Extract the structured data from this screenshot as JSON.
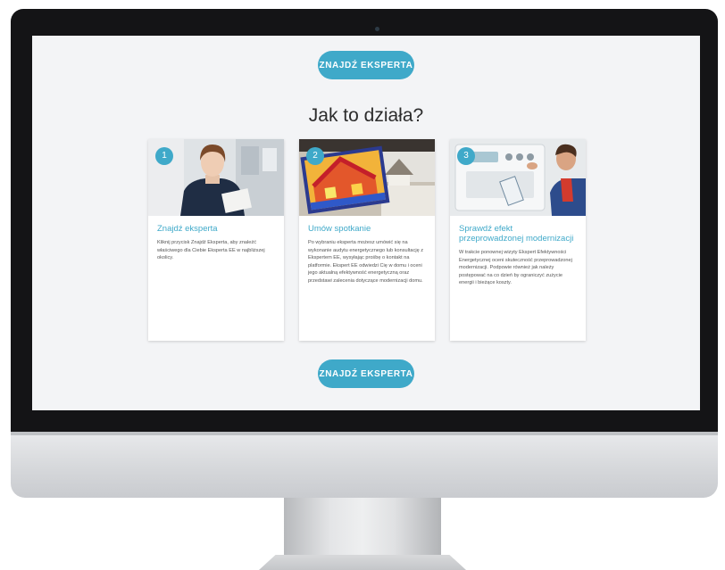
{
  "page": {
    "title": "Jak to działa?",
    "cta_top_label": "ZNAJDŹ EKSPERTA",
    "cta_bottom_label": "ZNAJDŹ EKSPERTA"
  },
  "steps": [
    {
      "number": "1",
      "title": "Znajdź eksperta",
      "text": "Kliknij przycisk Znajdź Eksperta, aby znaleźć właściwego dla Ciebie Eksperta EE w najbliższej okolicy."
    },
    {
      "number": "2",
      "title": "Umów spotkanie",
      "text": "Po wybraniu eksperta możesz umówić się na wykonanie audytu energetycznego lub konsultację z Ekspertem EE, wysyłając prośbę o kontakt na platformie. Ekspert EE odwiedzi Cię w domu i oceni jego aktualną efektywność energetyczną oraz przedstawi zalecenia dotyczące modernizacji domu."
    },
    {
      "number": "3",
      "title": "Sprawdź efekt przeprowadzonej modernizacji",
      "text": "W trakcie ponownej wizyty Ekspert Efektywności Energetycznej oceni skuteczność przeprowadzonej modernizacji. Podpowie również jak należy postępować na co dzień by ograniczyć zużycie energii i bieżące koszty."
    }
  ],
  "colors": {
    "accent": "#3fa9c9",
    "screen_background": "#f3f4f6",
    "monitor_bezel": "#141416"
  },
  "icons": {
    "card_1_image": "photo-expert-woman",
    "card_2_image": "photo-thermal-house",
    "card_3_image": "photo-technician-boiler"
  }
}
